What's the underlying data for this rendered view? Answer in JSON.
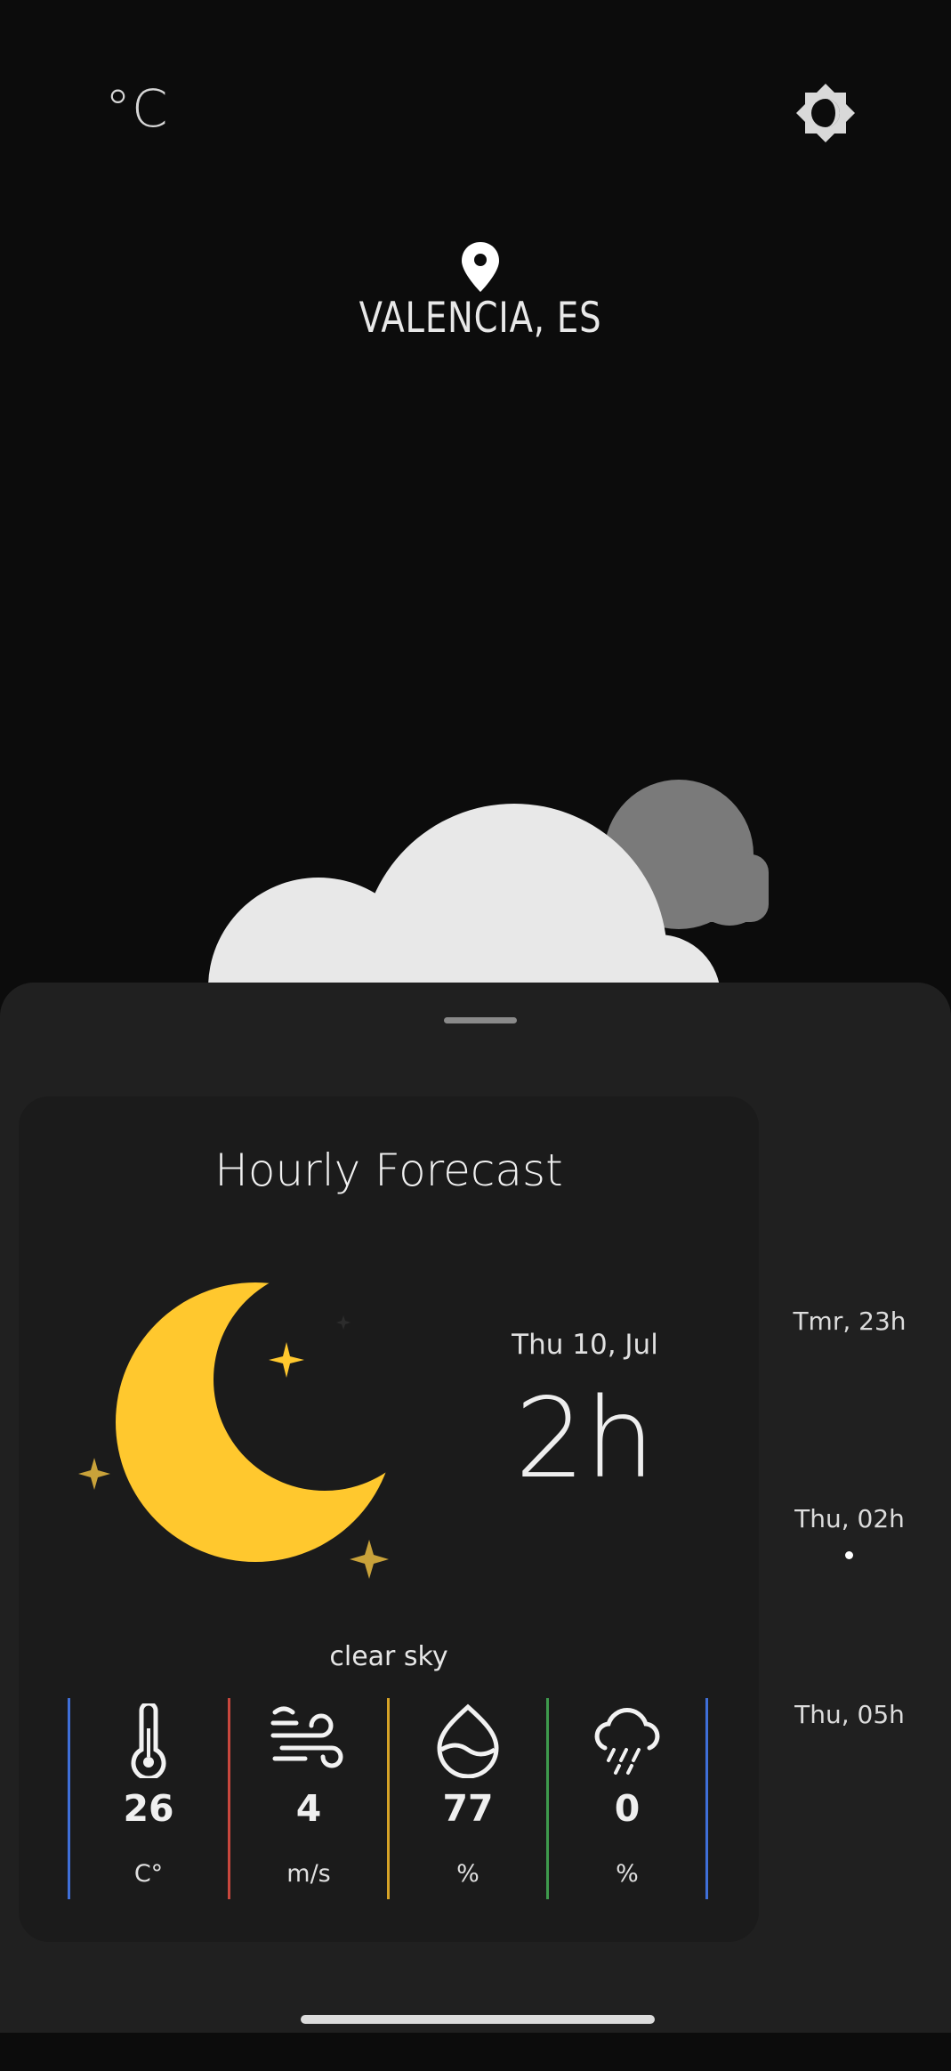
{
  "header": {
    "unit_toggle": "°C",
    "theme_toggle_icon": "brightness-icon",
    "location_icon": "location-pin-icon",
    "location": "VALENCIA, ES"
  },
  "hero": {
    "icon": "partly-cloudy-night-icon"
  },
  "card": {
    "title": "Hourly Forecast",
    "icon": "clear-night-moon-icon",
    "date": "Thu 10, Jul",
    "hour": "2h",
    "condition": "clear sky",
    "metrics": [
      {
        "icon": "thermometer-icon",
        "value": "26",
        "unit": "C°",
        "color": "#3f6fd8"
      },
      {
        "icon": "wind-icon",
        "value": "4",
        "unit": "m/s",
        "color": "#c8473d"
      },
      {
        "icon": "humidity-drop-icon",
        "value": "77",
        "unit": "%",
        "color": "#d6a327"
      },
      {
        "icon": "rain-cloud-icon",
        "value": "0",
        "unit": "%",
        "color": "#3e9a4d"
      }
    ],
    "last_divider_color": "#3f6fd8"
  },
  "timeline": [
    {
      "label": "Tmr, 23h"
    },
    {
      "label": "Thu, 02h",
      "selected": true
    },
    {
      "label": "Thu, 05h"
    }
  ],
  "colors": {
    "background": "#0c0c0c",
    "sheet": "#202020",
    "card": "#1b1b1b",
    "moon": "#ffc82e",
    "stars": "#c9a23a"
  }
}
